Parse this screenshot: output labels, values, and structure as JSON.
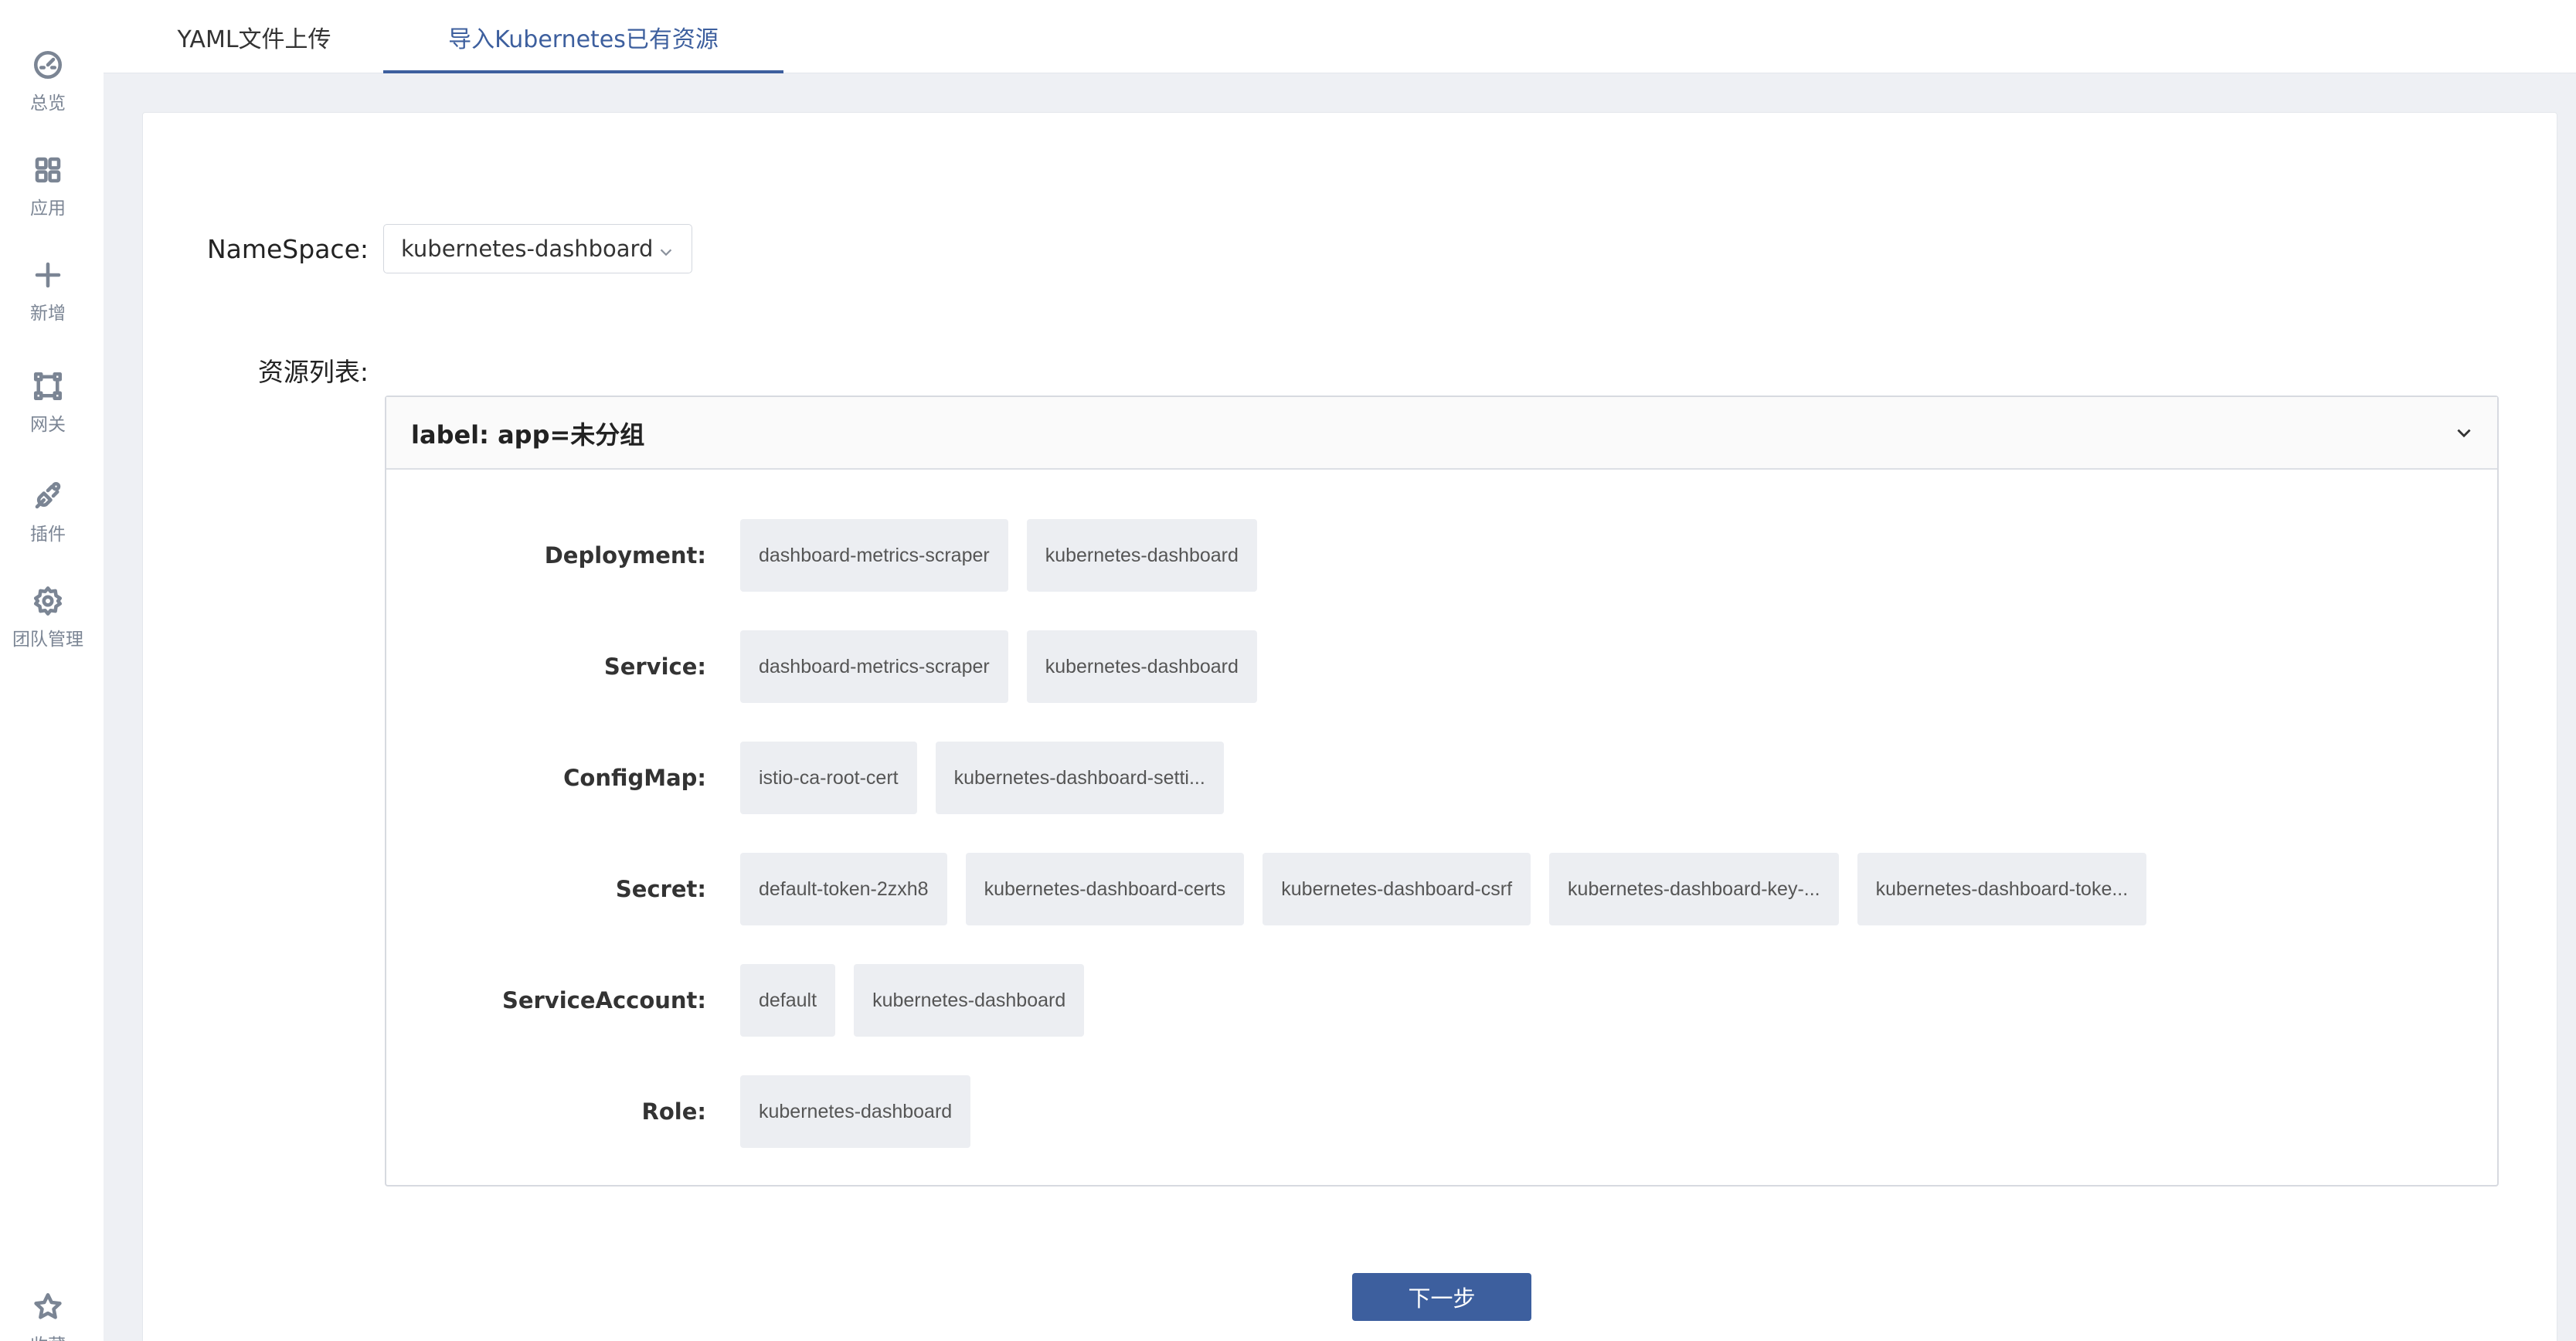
{
  "sidebar": {
    "items": [
      {
        "label": "总览",
        "icon": "dashboard-icon"
      },
      {
        "label": "应用",
        "icon": "apps-grid-icon"
      },
      {
        "label": "新增",
        "icon": "plus-icon"
      },
      {
        "label": "网关",
        "icon": "gateway-icon"
      },
      {
        "label": "插件",
        "icon": "plugin-icon"
      },
      {
        "label": "团队管理",
        "icon": "gear-icon"
      }
    ],
    "favorite": {
      "label": "收藏",
      "icon": "star-icon"
    }
  },
  "tabs": [
    {
      "label": "YAML文件上传",
      "active": false
    },
    {
      "label": "导入Kubernetes已有资源",
      "active": true
    }
  ],
  "form": {
    "namespace_label": "NameSpace:",
    "namespace_value": "kubernetes-dashboard",
    "resources_label": "资源列表:"
  },
  "panel": {
    "title": "label: app=未分组",
    "rows": [
      {
        "label": "Deployment:",
        "items": [
          "dashboard-metrics-scraper",
          "kubernetes-dashboard"
        ]
      },
      {
        "label": "Service:",
        "items": [
          "dashboard-metrics-scraper",
          "kubernetes-dashboard"
        ]
      },
      {
        "label": "ConfigMap:",
        "items": [
          "istio-ca-root-cert",
          "kubernetes-dashboard-setti..."
        ]
      },
      {
        "label": "Secret:",
        "items": [
          "default-token-2zxh8",
          "kubernetes-dashboard-certs",
          "kubernetes-dashboard-csrf",
          "kubernetes-dashboard-key-...",
          "kubernetes-dashboard-toke..."
        ]
      },
      {
        "label": "ServiceAccount:",
        "items": [
          "default",
          "kubernetes-dashboard"
        ]
      },
      {
        "label": "Role:",
        "items": [
          "kubernetes-dashboard"
        ]
      }
    ]
  },
  "actions": {
    "next_label": "下一步"
  },
  "colors": {
    "accent": "#3d5f9e",
    "background": "#eef0f4",
    "chip": "#eceef2"
  }
}
